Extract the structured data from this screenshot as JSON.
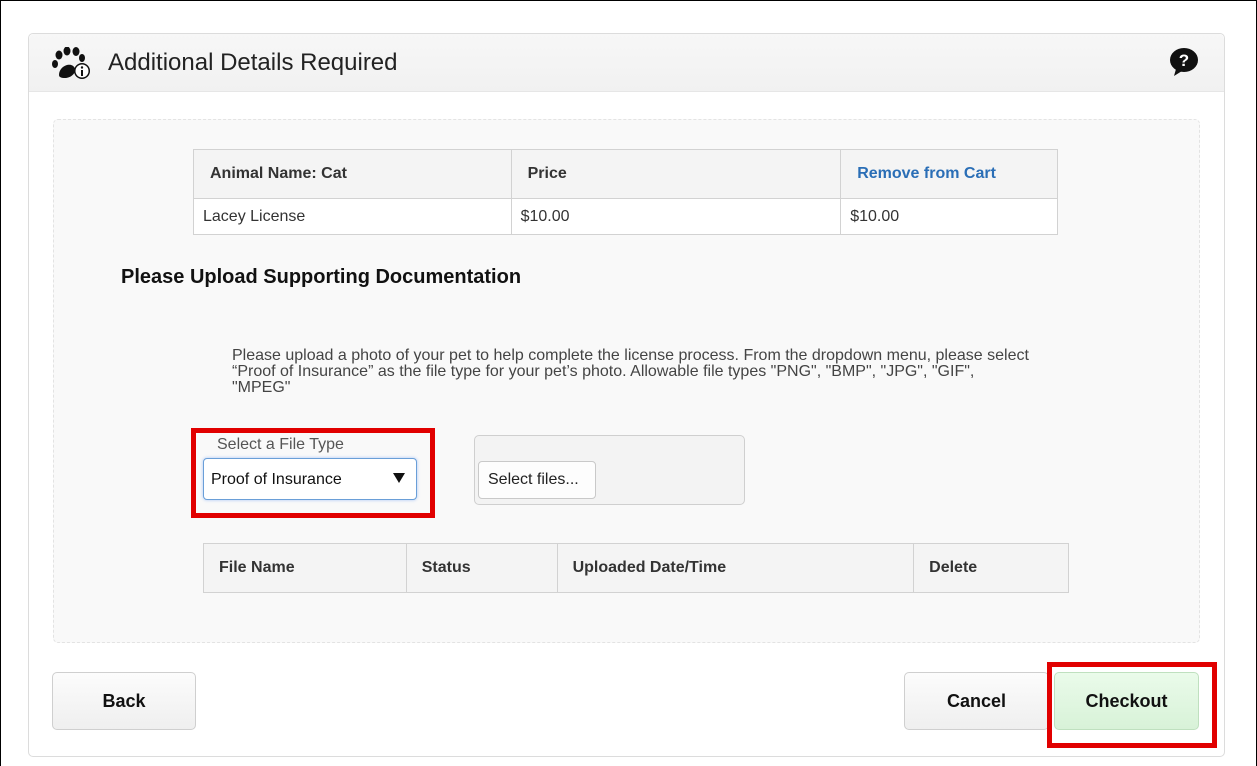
{
  "header": {
    "title": "Additional Details Required",
    "icon": "paw-info-icon",
    "help_icon": "help-bubble-icon"
  },
  "cart_table": {
    "headers": [
      "Animal Name: Cat",
      "Price",
      "Remove from Cart"
    ],
    "rows": [
      [
        "Lacey License",
        "$10.00",
        "$10.00"
      ]
    ],
    "link_color": "#2a6eb6"
  },
  "upload_section": {
    "title": "Please Upload Supporting Documentation",
    "instructions": "Please upload a photo of your pet to help complete the license process. From the dropdown menu, please select “Proof of Insurance” as the file type for your pet’s photo. Allowable file types \"PNG\", \"BMP\", \"JPG\", \"GIF\", \"MPEG\"",
    "file_type_label": "Select a File Type",
    "file_type_value": "Proof of Insurance",
    "select_files_label": "Select files..."
  },
  "files_table": {
    "headers": [
      "File Name",
      "Status",
      "Uploaded Date/Time",
      "Delete"
    ]
  },
  "buttons": {
    "back": "Back",
    "cancel": "Cancel",
    "checkout": "Checkout"
  },
  "highlight_color": "#e10000"
}
